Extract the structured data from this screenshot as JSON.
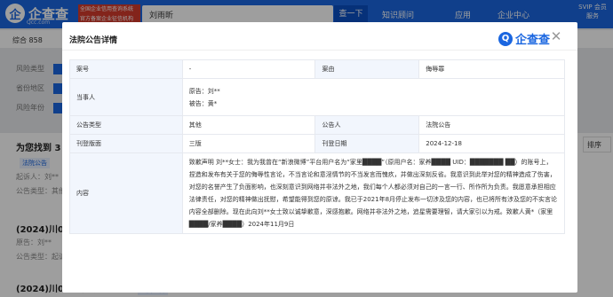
{
  "header": {
    "logo_text": "企查查",
    "logo_sub": "Qcc.com",
    "banner_text": "全国企业信用查询系统 官方备案企业征信机构",
    "search_value": "刘雨昕",
    "search_button": "查一下",
    "links": [
      "知识顾问",
      "应用",
      "企业中心"
    ],
    "vip_label": "SVIP 会员服务"
  },
  "background": {
    "tabs_text": "综合 858",
    "filters": [
      "风险类型",
      "省份地区",
      "风险年份"
    ],
    "results_label": "为您找到 3 条",
    "sort_label": "排序",
    "records": [
      {
        "case_no": "",
        "tag": "法院公告",
        "line1": "起诉人：刘**",
        "line2": "公告类型：其他"
      },
      {
        "case_no": "(2024)川01",
        "tag": "",
        "line1": "原告：刘**",
        "line2": "公告类型：起诉"
      },
      {
        "case_no": "(2024)川0193民初1667号",
        "tag": "法院公告",
        "line1": "",
        "line2": ""
      }
    ]
  },
  "modal": {
    "title": "法院公告详情",
    "logo_text": "企查查",
    "rows": {
      "case_no_label": "案号",
      "case_no_value": "-",
      "cause_label": "案由",
      "cause_value": "侮辱罪",
      "parties_label": "当事人",
      "plaintiff": "原告：刘**",
      "defendant": "被告：黄*",
      "type_label": "公告类型",
      "type_value": "其他",
      "announcer_label": "公告人",
      "announcer_value": "法院公告",
      "page_label": "刊登版面",
      "page_value": "三版",
      "date_label": "刊登日期",
      "date_value": "2024-12-18",
      "content_label": "内容",
      "content_value": "致歉声明 刘**女士：我为我曾在“新浪微博”平台用户名为“家里████”（原用户名：家养████ UID：███████ ██）的账号上，捏造和发布有关于您的侮辱性言论，不当言论和意淫情节的不当发言而愧疚，并做出深刻反省。我意识到此举对您的精神造成了伤害，对您的名誉产生了负面影响，也深刻意识到网络并非法外之地，我们每个人都必须对自己的一言一行、所作所为负责。我愿意承担相应法律责任，对您的精神做出抚慰，希望能得到您的原谅。我已于2021年8月停止发布一切涉及您的内容，也已将所有涉及您的不实言论内容全部删除。现在此向刘**女士致以诚挚歉意，深感抱歉。网络并非法外之地，追星需要理智，请大家引以为戒。致歉人黄*（家里████/家养████）2024年11月9日"
    }
  }
}
